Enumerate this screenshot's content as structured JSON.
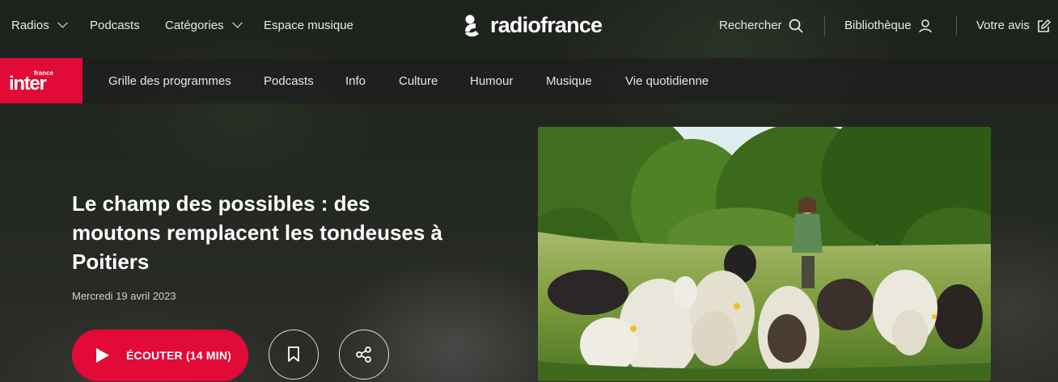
{
  "topbar": {
    "radios": "Radios",
    "podcasts": "Podcasts",
    "categories": "Catégories",
    "espace_musique": "Espace musique",
    "brand": "radiofrance",
    "search": "Rechercher",
    "library": "Bibliothèque",
    "feedback": "Votre avis"
  },
  "channel": {
    "logo_small": "france",
    "logo_big": "inter",
    "nav": [
      "Grille des programmes",
      "Podcasts",
      "Info",
      "Culture",
      "Humour",
      "Musique",
      "Vie quotidienne"
    ]
  },
  "article": {
    "title": "Le champ des possibles : des moutons remplacent les tondeuses à Poitiers",
    "date": "Mercredi 19 avril 2023",
    "listen_label": "ÉCOUTER (14 MIN)"
  },
  "colors": {
    "accent": "#e20a36"
  },
  "icons": [
    "chevron-down-icon",
    "search-icon",
    "user-icon",
    "edit-icon",
    "play-icon",
    "bookmark-icon",
    "share-icon"
  ]
}
